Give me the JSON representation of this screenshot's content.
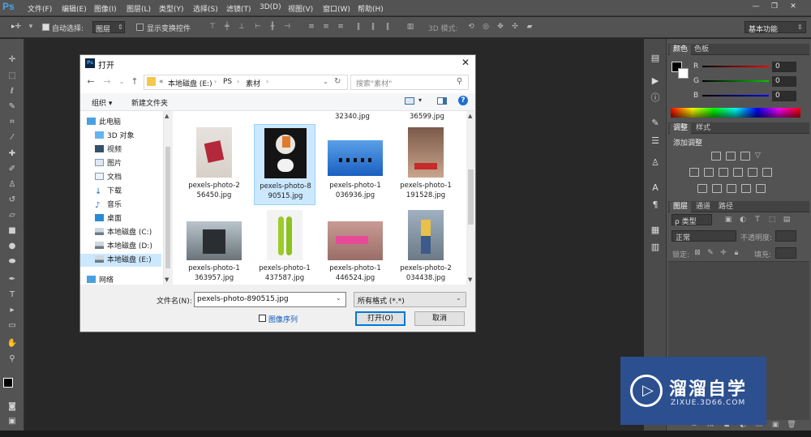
{
  "app": {
    "logo": "Ps"
  },
  "menu": [
    "文件(F)",
    "编辑(E)",
    "图像(I)",
    "图层(L)",
    "类型(Y)",
    "选择(S)",
    "滤镜(T)",
    "3D(D)",
    "视图(V)",
    "窗口(W)",
    "帮助(H)"
  ],
  "window_controls": {
    "minimize": "—",
    "restore": "❐",
    "close": "✕"
  },
  "options_bar": {
    "auto_select_label": "自动选择:",
    "auto_select_value": "图层",
    "show_transform_label": "显示变换控件",
    "mode_3d_label": "3D 模式:",
    "workspace": "基本功能"
  },
  "color_panel": {
    "tabs": [
      "颜色",
      "色板"
    ],
    "channels": [
      {
        "name": "R",
        "value": "0"
      },
      {
        "name": "G",
        "value": "0"
      },
      {
        "name": "B",
        "value": "0"
      }
    ]
  },
  "adjust_panel": {
    "tabs": [
      "调整",
      "样式"
    ],
    "title": "添加调整"
  },
  "layers_panel": {
    "tabs": [
      "图层",
      "通道",
      "路径"
    ],
    "kind_label": "ρ 类型",
    "blend_mode": "正常",
    "opacity_label": "不透明度:",
    "lock_label": "锁定:",
    "fill_label": "填充:"
  },
  "dialog": {
    "title": "打开",
    "breadcrumb": [
      "«",
      "本地磁盘 (E:)",
      "PS",
      "素材"
    ],
    "search_placeholder": "搜索\"素材\"",
    "organize": "组织 ▾",
    "new_folder": "新建文件夹",
    "nav_items": [
      {
        "label": "此电脑",
        "icon": "computer-icon"
      },
      {
        "label": "3D 对象",
        "icon": "3d-objects-icon"
      },
      {
        "label": "视频",
        "icon": "video-icon"
      },
      {
        "label": "图片",
        "icon": "pictures-icon"
      },
      {
        "label": "文档",
        "icon": "documents-icon"
      },
      {
        "label": "下载",
        "icon": "download-icon"
      },
      {
        "label": "音乐",
        "icon": "music-icon"
      },
      {
        "label": "桌面",
        "icon": "desktop-icon"
      },
      {
        "label": "本地磁盘 (C:)",
        "icon": "drive-icon"
      },
      {
        "label": "本地磁盘 (D:)",
        "icon": "drive-icon"
      },
      {
        "label": "本地磁盘 (E:)",
        "icon": "drive-icon"
      },
      {
        "label": "网络",
        "icon": "network-icon"
      }
    ],
    "top_partial_files": [
      "32340.jpg",
      "36599.jpg"
    ],
    "files": [
      {
        "name_line1": "pexels-photo-2",
        "name_line2": "56450.jpg",
        "selected": false
      },
      {
        "name_line1": "pexels-photo-8",
        "name_line2": "90515.jpg",
        "selected": true
      },
      {
        "name_line1": "pexels-photo-1",
        "name_line2": "036936.jpg",
        "selected": false
      },
      {
        "name_line1": "pexels-photo-1",
        "name_line2": "191528.jpg",
        "selected": false
      },
      {
        "name_line1": "pexels-photo-1",
        "name_line2": "363957.jpg",
        "selected": false
      },
      {
        "name_line1": "pexels-photo-1",
        "name_line2": "437587.jpg",
        "selected": false
      },
      {
        "name_line1": "pexels-photo-1",
        "name_line2": "446524.jpg",
        "selected": false
      },
      {
        "name_line1": "pexels-photo-2",
        "name_line2": "034438.jpg",
        "selected": false
      }
    ],
    "filename_label": "文件名(N):",
    "filename_value": "pexels-photo-890515.jpg",
    "filetype_value": "所有格式 (*.*)",
    "image_sequence": "图像序列",
    "open_button": "打开(O)",
    "cancel_button": "取消"
  },
  "watermark": {
    "brand": "溜溜自学",
    "url": "ZIXUE.3D66.COM"
  }
}
